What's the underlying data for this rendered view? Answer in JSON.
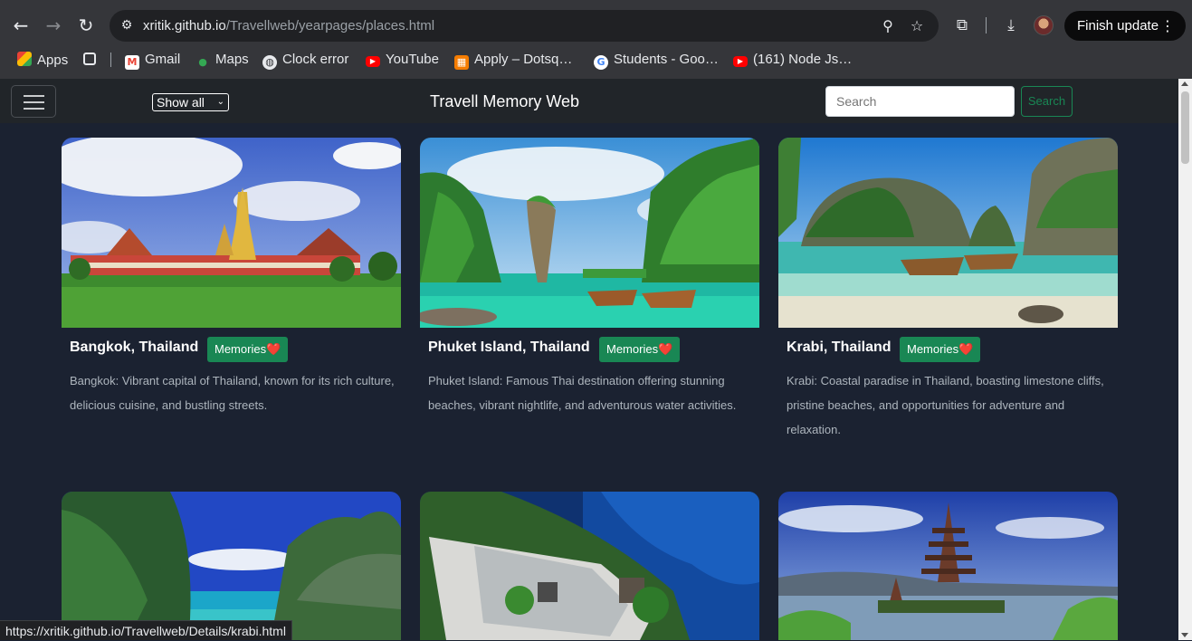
{
  "browser": {
    "url_host": "xritik.github.io",
    "url_path": "/Travellweb/yearpages/places.html",
    "finish_update_label": "Finish update",
    "bookmarks": [
      {
        "label": "Apps",
        "icon": "apps-grid-icon"
      },
      {
        "label": "",
        "icon": "grid-icon"
      },
      {
        "label": "Gmail",
        "icon": "gmail-icon"
      },
      {
        "label": "Maps",
        "icon": "maps-pin-icon"
      },
      {
        "label": "Clock error",
        "icon": "globe-icon"
      },
      {
        "label": "YouTube",
        "icon": "youtube-icon"
      },
      {
        "label": "Apply – Dotsq…",
        "icon": "dotsquares-icon"
      },
      {
        "label": "Students - Goo…",
        "icon": "google-icon"
      },
      {
        "label": "(161) Node Js…",
        "icon": "youtube-icon"
      }
    ],
    "status_url": "https://xritik.github.io/Travellweb/Details/krabi.html"
  },
  "navbar": {
    "filter_selected": "Show all",
    "brand": "Travell Memory Web",
    "search_placeholder": "Search",
    "search_button": "Search"
  },
  "cards": [
    {
      "title": "Bangkok, Thailand",
      "badge": "Memories❤️",
      "text": "Bangkok: Vibrant capital of Thailand, known for its rich culture, delicious cuisine, and bustling streets."
    },
    {
      "title": "Phuket Island, Thailand",
      "badge": "Memories❤️",
      "text": "Phuket Island: Famous Thai destination offering stunning beaches, vibrant nightlife, and adventurous water activities."
    },
    {
      "title": "Krabi, Thailand",
      "badge": "Memories❤️",
      "text": "Krabi: Coastal paradise in Thailand, boasting limestone cliffs, pristine beaches, and opportunities for adventure and relaxation."
    }
  ],
  "colors": {
    "page_bg": "#1b2231",
    "navbar_bg": "#212529",
    "accent_green": "#198754"
  }
}
